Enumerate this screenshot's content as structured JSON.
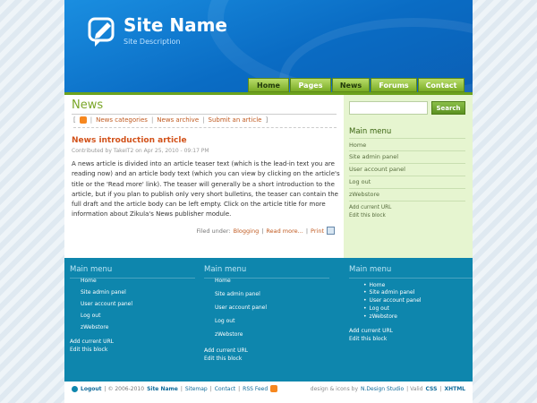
{
  "header": {
    "site_name": "Site Name",
    "site_description": "Site Description",
    "logo_icon": "speech-bubble-pencil-icon"
  },
  "nav": {
    "items": [
      {
        "label": "Home",
        "active": true
      },
      {
        "label": "Pages",
        "active": false
      },
      {
        "label": "News",
        "active": true
      },
      {
        "label": "Forums",
        "active": false
      },
      {
        "label": "Contact",
        "active": false
      }
    ]
  },
  "main": {
    "title": "News",
    "subnav": {
      "rss_icon": "rss-icon",
      "categories": "News categories",
      "archive": "News archive",
      "submit": "Submit an article"
    },
    "article": {
      "title": "News introduction article",
      "contributed": "Contributed by TakeIT2 on Apr 25, 2010 - 09:17 PM",
      "body": "A news article is divided into an article teaser text (which is the lead-in text you are reading now) and an article body text (which you can view by clicking on the article's title or the 'Read more' link). The teaser will generally be a short introduction to the article, but if you plan to publish only very short bulletins, the teaser can contain the full draft and the article body can be left empty. Click on the article title for more information about Zikula's News publisher module.",
      "filed_under": "Filed under:",
      "category": "Blogging",
      "read_more": "Read more...",
      "print": "Print",
      "print_icon": "printer-icon"
    }
  },
  "sidebar": {
    "search_placeholder": "",
    "search_button": "Search",
    "menu_title": "Main menu",
    "items": [
      "Home",
      "Site admin panel",
      "User account panel",
      "Log out",
      "zWebstore"
    ],
    "add_url": "Add current URL",
    "edit_block": "Edit this block"
  },
  "footer": {
    "columns": [
      {
        "title": "Main menu",
        "items": [
          "Home",
          "Site admin panel",
          "User account panel",
          "Log out",
          "zWebstore"
        ],
        "add_url": "Add current URL",
        "edit_block": "Edit this block"
      },
      {
        "title": "Main menu",
        "items": [
          "Home",
          "Site admin panel",
          "User account panel",
          "Log out",
          "zWebstore"
        ],
        "add_url": "Add current URL",
        "edit_block": "Edit this block"
      },
      {
        "title": "Main menu",
        "items": [
          "Home",
          "Site admin panel",
          "User account panel",
          "Log out",
          "zWebstore"
        ],
        "add_url": "Add current URL",
        "edit_block": "Edit this block"
      }
    ]
  },
  "bottom": {
    "logout": "Logout",
    "copyright": "| © 2006-2010",
    "site_name": "Site Name",
    "sitemap": "Sitemap",
    "contact": "Contact",
    "rss": "RSS Feed",
    "design": "design & icons by",
    "design_by": "N.Design Studio",
    "valid": "| Valid",
    "css": "CSS",
    "xhtml": "XHTML",
    "sep": "|"
  }
}
